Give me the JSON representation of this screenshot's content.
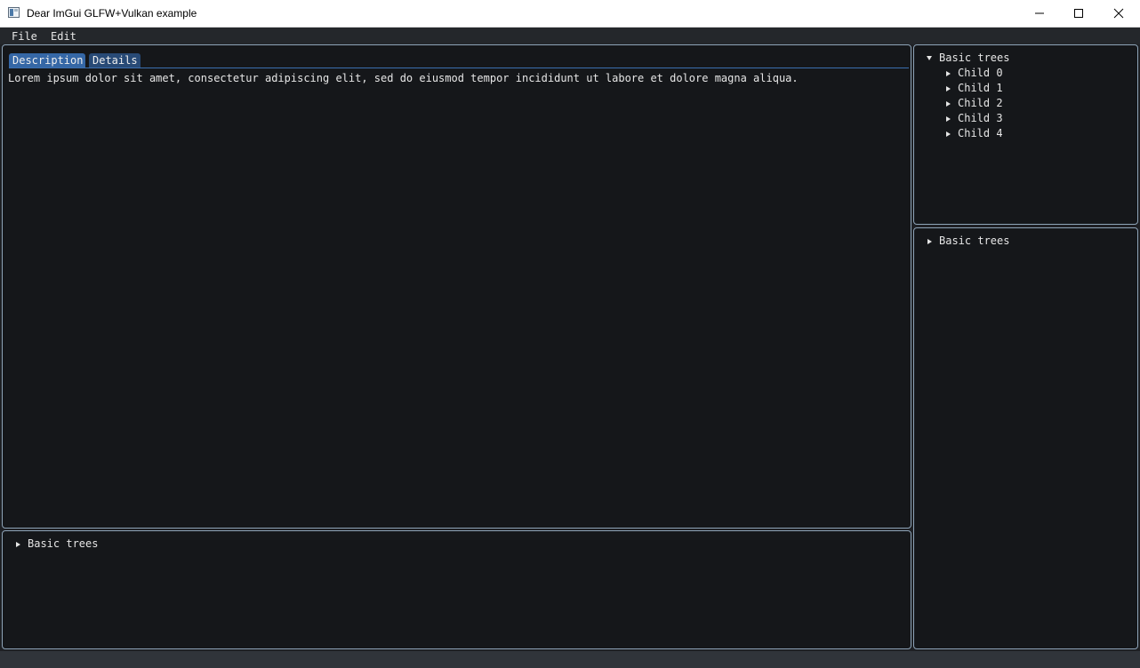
{
  "window": {
    "title": "Dear ImGui GLFW+Vulkan example"
  },
  "menu": {
    "file": "File",
    "edit": "Edit"
  },
  "main_panel": {
    "tabs": [
      "Description",
      "Details"
    ],
    "active_tab": "Description",
    "text": "Lorem ipsum dolor sit amet, consectetur adipiscing elit, sed do eiusmod tempor incididunt ut labore et dolore magna aliqua."
  },
  "bottom_panel": {
    "tree_label": "Basic trees",
    "expanded": false
  },
  "right_top_panel": {
    "tree_label": "Basic trees",
    "expanded": true,
    "children": [
      "Child 0",
      "Child 1",
      "Child 2",
      "Child 3",
      "Child 4"
    ]
  },
  "right_bottom_panel": {
    "tree_label": "Basic trees",
    "expanded": false
  },
  "colors": {
    "panel_bg": "#15171a",
    "panel_border": "#8ea4b8",
    "tab_active": "#3567a6",
    "tab_inactive": "#284a76",
    "text": "#e6e6e6"
  }
}
